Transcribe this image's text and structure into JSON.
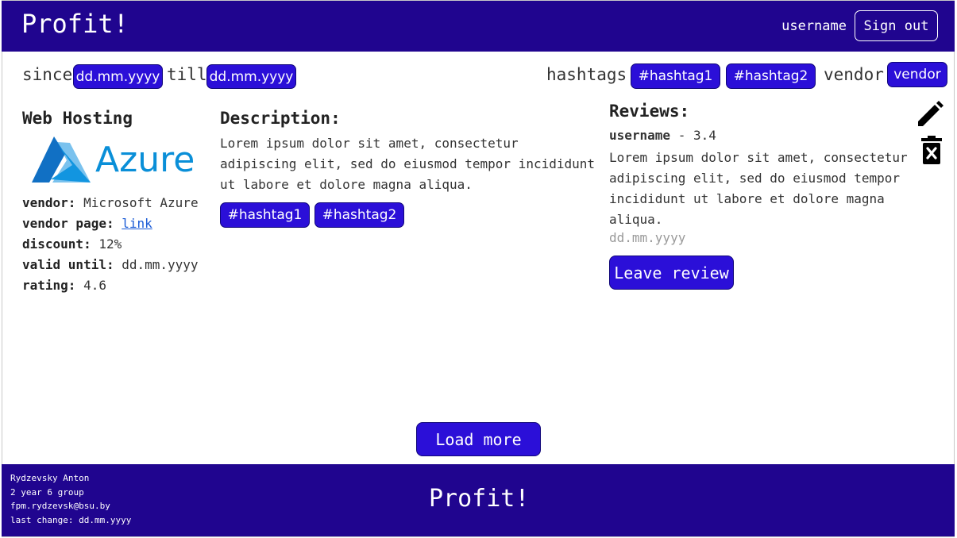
{
  "header": {
    "brand": "Profit!",
    "username": "username",
    "signout_label": "Sign out"
  },
  "filters": {
    "since_label": "since",
    "since_value": "dd.mm.yyyy",
    "till_label": "till",
    "till_value": "dd.mm.yyyy",
    "hashtags_label": "hashtags:",
    "hashtags": [
      "#hashtag1",
      "#hashtag2"
    ],
    "vendor_label": "vendor:",
    "vendor_value": "vendor"
  },
  "offer": {
    "title": "Web Hosting",
    "logo_text": "Azure",
    "vendor_key": "vendor:",
    "vendor": "Microsoft Azure",
    "vendor_page_key": "vendor page:",
    "vendor_page_link": "link",
    "discount_key": "discount:",
    "discount": "12%",
    "valid_until_key": "valid until:",
    "valid_until": "dd.mm.yyyy",
    "rating_key": "rating:",
    "rating": "4.6",
    "description_title": "Description:",
    "description": "Lorem ipsum dolor sit amet, consectetur adipiscing elit, sed do eiusmod tempor incididunt ut labore et dolore magna aliqua.",
    "hashtags": [
      "#hashtag1",
      "#hashtag2"
    ]
  },
  "reviews": {
    "title": "Reviews:",
    "items": [
      {
        "username": "username",
        "separator": " - ",
        "rating": "3.4",
        "text": "Lorem ipsum dolor sit amet, consectetur adipiscing elit, sed do eiusmod tempor incididunt ut labore et dolore magna aliqua.",
        "date": "dd.mm.yyyy"
      }
    ],
    "leave_review_label": "Leave review"
  },
  "actions": {
    "edit_icon": "pencil-icon",
    "delete_icon": "trash-icon"
  },
  "load_more_label": "Load more",
  "footer": {
    "author": "Rydzevsky Anton",
    "group": "2 year 6 group",
    "email": "fpm.rydzevsk@bsu.by",
    "last_change": "last change: dd.mm.yyyy",
    "brand": "Profit!"
  },
  "colors": {
    "primary_dark": "#20058f",
    "primary": "#2b0fd8",
    "azure_blue": "#0a8fd8"
  }
}
